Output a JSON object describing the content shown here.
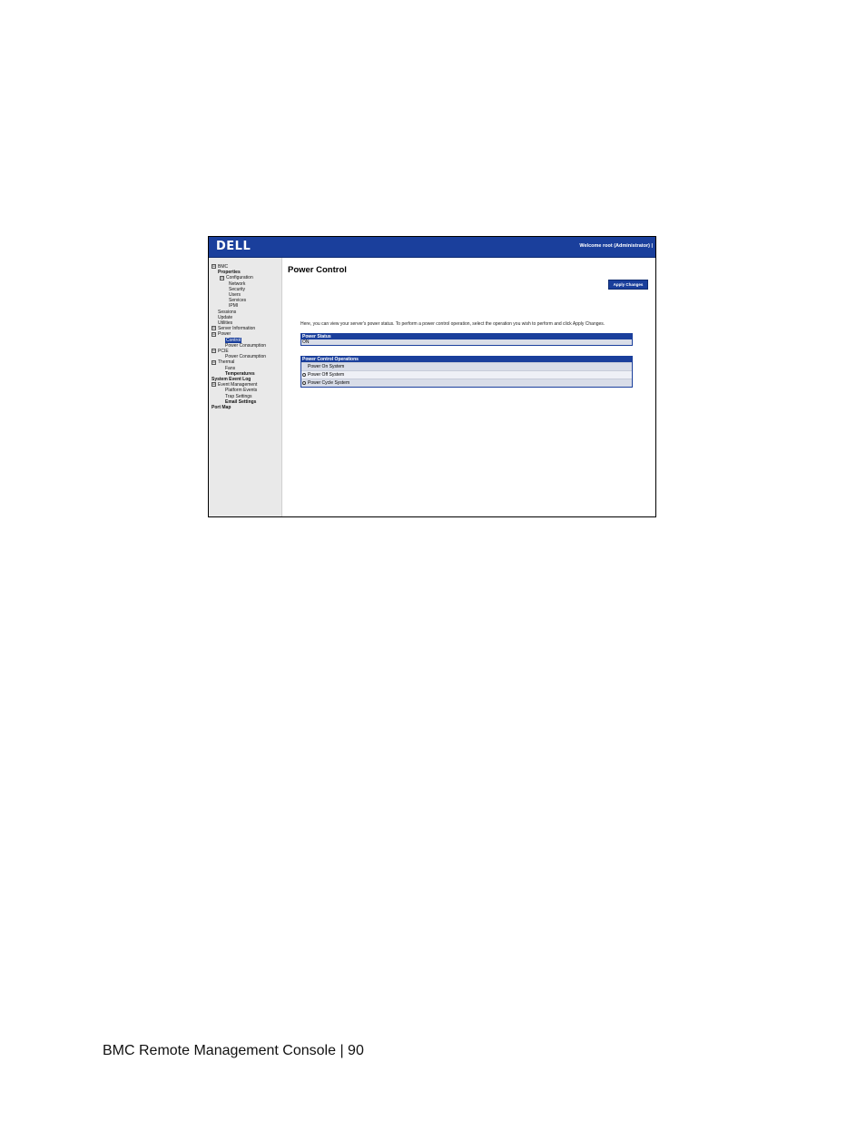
{
  "screenshot": {
    "logo": "D&#x30C8;LL",
    "logo_text": "DELL",
    "welcome": "Welcome root (Administrator) |",
    "sidebar": {
      "items": [
        {
          "label": "BMC",
          "expand": "⊟"
        },
        {
          "label": "Properties"
        },
        {
          "label": "Configuration",
          "expand": "⊟"
        },
        {
          "label": "Network"
        },
        {
          "label": "Security"
        },
        {
          "label": "Users"
        },
        {
          "label": "Services"
        },
        {
          "label": "IPMI"
        },
        {
          "label": "Sessions"
        },
        {
          "label": "Update"
        },
        {
          "label": "Utilities"
        },
        {
          "label": "Server Information",
          "expand": "⊟"
        },
        {
          "label": "Power",
          "expand": "⊟"
        },
        {
          "label": "Control"
        },
        {
          "label": "Power Consumption"
        },
        {
          "label": "PCIE",
          "expand": "⊟"
        },
        {
          "label": "Power Consumption"
        },
        {
          "label": "Thermal",
          "expand": "⊟"
        },
        {
          "label": "Fans"
        },
        {
          "label": "Temperatures"
        },
        {
          "label": "System Event Log"
        },
        {
          "label": "Event Management",
          "expand": "⊟"
        },
        {
          "label": "Platform Events"
        },
        {
          "label": "Trap Settings"
        },
        {
          "label": "Email Settings"
        },
        {
          "label": "Port Map"
        }
      ]
    },
    "main": {
      "title": "Power Control",
      "apply_label": "Apply Changes",
      "description": "Here, you can view your server's power status. To perform a power control operation, select the operation you wish to perform and click Apply Changes.",
      "power_status": {
        "header": "Power Status",
        "value": "ON"
      },
      "operations": {
        "header": "Power Control Operations",
        "options": [
          {
            "label": "Power On System"
          },
          {
            "label": "Power Off System"
          },
          {
            "label": "Power Cycle System"
          }
        ]
      }
    }
  },
  "footer": {
    "text": "BMC Remote Management Console | 90"
  }
}
